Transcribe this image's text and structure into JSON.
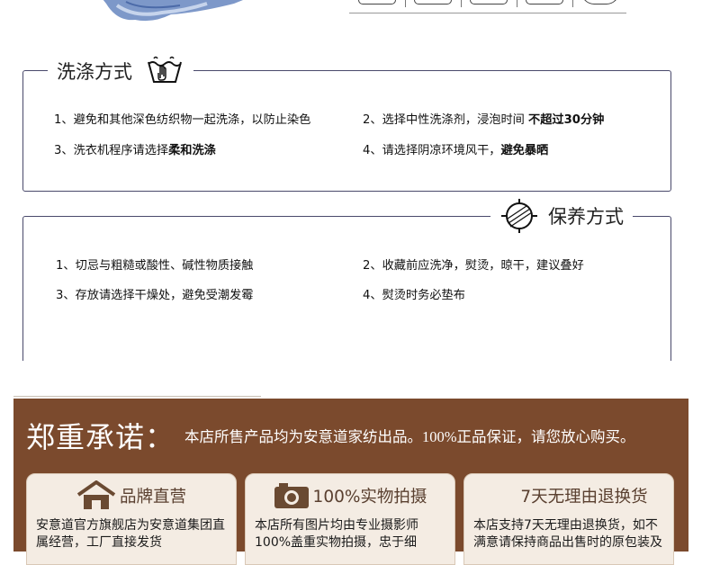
{
  "wash_section": {
    "title": "洗涤方式",
    "lines": [
      {
        "text": "1、避免和其他深色纺织物一起洗涤，以防止染色",
        "bold": ""
      },
      {
        "text": "2、选择中性洗涤剂，浸泡时间 ",
        "bold": "不超过30分钟"
      },
      {
        "text": "3、洗衣机程序请选择",
        "bold": "柔和洗涤"
      },
      {
        "text": "4、请选择阴凉环境风干，",
        "bold": "避免暴晒"
      }
    ]
  },
  "maintenance_section": {
    "title": "保养方式",
    "lines": [
      {
        "text": "1、切忌与粗糙或酸性、碱性物质接触"
      },
      {
        "text": "2、收藏前应洗净，熨烫，晾干，建议叠好"
      },
      {
        "text": "3、存放请选择干燥处，避免受潮发霉"
      },
      {
        "text": "4、熨烫时务必垫布"
      }
    ]
  },
  "promise": {
    "title": "郑重承诺：",
    "text": "本店所售产品均为安意道家纺出品。100%正品保证，请您放心购买。",
    "cards": [
      {
        "icon": "house-icon",
        "title": "品牌直营",
        "body": "安意道官方旗舰店为安意道集团直属经营，工厂直接发货"
      },
      {
        "icon": "camera-icon",
        "title": "100%实物拍摄",
        "body": "本店所有图片均由专业摄影师100%盖重实物拍摄，忠于细"
      },
      {
        "icon": "",
        "title": "7天无理由退换货",
        "body": "本店支持7天无理由退换货，如不满意请保持商品出售时的原包装及"
      }
    ]
  },
  "colors": {
    "border": "#49496b",
    "promise_bg": "#7b4a2d",
    "card_bg": "#f4ece3"
  }
}
